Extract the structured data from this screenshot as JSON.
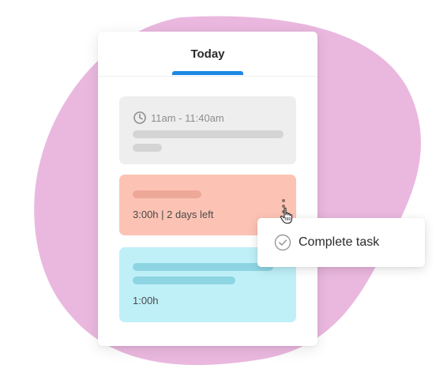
{
  "colors": {
    "blob": "#eab8df",
    "tab_accent": "#1e88e5",
    "task_gray": "#eeeeee",
    "task_orange": "#fcc3b4",
    "task_blue": "#bff0f8"
  },
  "tabs": {
    "today_label": "Today"
  },
  "tasks": [
    {
      "time_icon": "clock-icon",
      "time_range": "11am - 11:40am"
    },
    {
      "meta": "3:00h | 2 days left",
      "menu_icon": "more-vertical-icon"
    },
    {
      "meta": "1:00h"
    }
  ],
  "context_menu": {
    "items": [
      {
        "icon": "check-circle-icon",
        "label": "Complete task"
      }
    ]
  },
  "cursor": "hand-pointer-icon"
}
